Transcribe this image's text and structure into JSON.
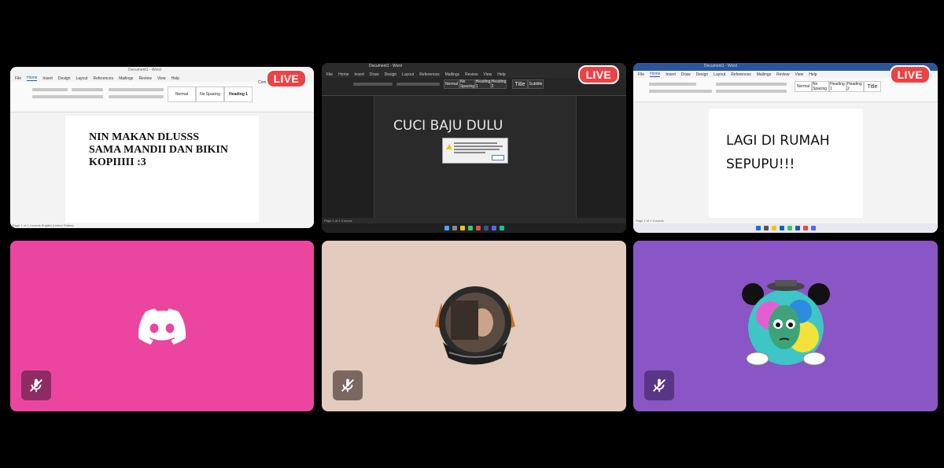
{
  "screens": [
    {
      "live_label": "LIVE",
      "doc_text": "NIN MAKAN DLUSSS\nSAMA MANDII DAN BIKIN\nKOPIIIII :3",
      "title": "Document1 - Word",
      "menu": [
        "File",
        "Home",
        "Insert",
        "Design",
        "Layout",
        "References",
        "Mailings",
        "Review",
        "View",
        "Help"
      ],
      "styles": [
        "Normal",
        "No Spacing",
        "Heading 1"
      ],
      "comments_label": "Comments",
      "status": "Page 1 of 1   4 words   English (United States)"
    },
    {
      "live_label": "LIVE",
      "doc_text": "CUCI BAJU DULU",
      "title": "Document1 - Word",
      "menu": [
        "File",
        "Home",
        "Insert",
        "Draw",
        "Design",
        "Layout",
        "References",
        "Mailings",
        "Review",
        "View",
        "Help"
      ],
      "styles": [
        "Normal",
        "No Spacing",
        "Heading 1",
        "Heading 2",
        "Title",
        "Subtitle"
      ],
      "status": "Page 1 of 1   3 words"
    },
    {
      "live_label": "LIVE",
      "doc_text": "LAGI DI RUMAH\nSEPUPU!!!",
      "title": "Document1 - Word",
      "menu": [
        "File",
        "Home",
        "Insert",
        "Draw",
        "Design",
        "Layout",
        "References",
        "Mailings",
        "Review",
        "View",
        "Help"
      ],
      "styles": [
        "Normal",
        "No Spacing",
        "Heading 1",
        "Heading 2",
        "Title"
      ],
      "status": "Page 1 of 1   5 words"
    }
  ],
  "participants": [
    {
      "bg": "#eb459f",
      "avatar": "discord-logo",
      "muted": true
    },
    {
      "bg": "#e3cbbd",
      "avatar": "avatar-image",
      "muted": true
    },
    {
      "bg": "#8a55c4",
      "avatar": "avatar-image",
      "muted": true
    }
  ],
  "colors": {
    "live": "#ed4245",
    "pink": "#eb459f",
    "beige": "#e3cbbd",
    "purple": "#8a55c4"
  }
}
